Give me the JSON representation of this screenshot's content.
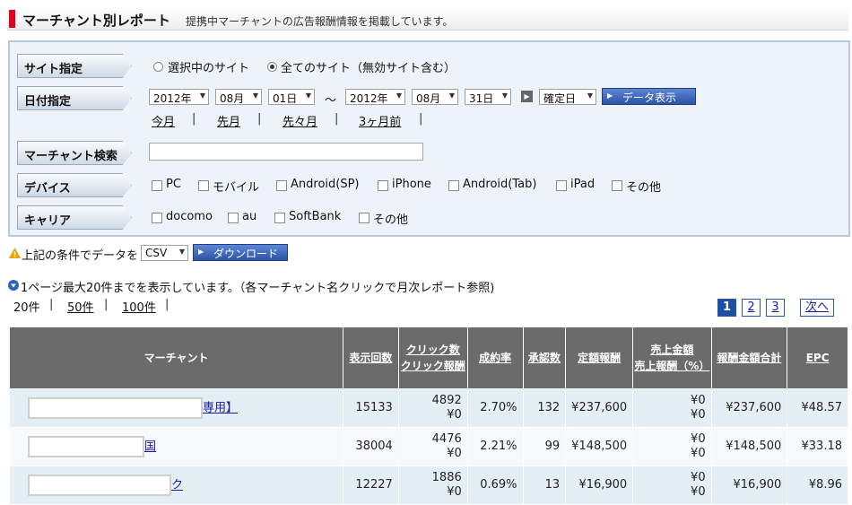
{
  "title": {
    "main": "マーチャント別レポート",
    "sub": "提携中マーチャントの広告報酬情報を掲載しています。"
  },
  "filters": {
    "site_label": "サイト指定",
    "site_options": [
      "選択中のサイト",
      "全てのサイト（無効サイト含む）"
    ],
    "site_selected": 1,
    "date_label": "日付指定",
    "from": {
      "year": "2012年",
      "month": "08月",
      "day": "01日"
    },
    "tilde": "～",
    "to": {
      "year": "2012年",
      "month": "08月",
      "day": "31日"
    },
    "date_type": "確定日",
    "show_button": "データ表示",
    "quick_links": [
      "今月",
      "先月",
      "先々月",
      "3ヶ月前"
    ],
    "merchant_search_label": "マーチャント検索",
    "merchant_search_value": "",
    "device_label": "デバイス",
    "devices": [
      "PC",
      "モバイル",
      "Android(SP)",
      "iPhone",
      "Android(Tab)",
      "iPad",
      "その他"
    ],
    "carrier_label": "キャリア",
    "carriers": [
      "docomo",
      "au",
      "SoftBank",
      "その他"
    ]
  },
  "download": {
    "label": "上記の条件でデータを",
    "format": "CSV",
    "button": "ダウンロード"
  },
  "notice": "1ページ最大20件までを表示しています。（各マーチャント名クリックで月次レポート参照)",
  "per_page": {
    "current": "20件",
    "options": [
      "50件",
      "100件"
    ]
  },
  "pagination": {
    "pages": [
      "1",
      "2",
      "3"
    ],
    "current": "1",
    "next": "次へ"
  },
  "table": {
    "headers": {
      "merchant": "マーチャント",
      "impressions": "表示回数",
      "clicks": "クリック数",
      "click_reward": "クリック報酬",
      "cvr": "成約率",
      "approved": "承認数",
      "fixed_reward": "定額報酬",
      "sales_amount": "売上金額",
      "sales_reward": "売上報酬（%）",
      "reward_total": "報酬金額合計",
      "epc": "EPC"
    },
    "rows": [
      {
        "merchant": "専用】",
        "impressions": "15133",
        "clicks": "4892",
        "click_reward": "¥0",
        "cvr": "2.70%",
        "approved": "132",
        "fixed_reward": "¥237,600",
        "sales_amount": "¥0",
        "sales_reward": "¥0",
        "reward_total": "¥237,600",
        "epc": "¥48.57"
      },
      {
        "merchant": "国",
        "impressions": "38004",
        "clicks": "4476",
        "click_reward": "¥0",
        "cvr": "2.21%",
        "approved": "99",
        "fixed_reward": "¥148,500",
        "sales_amount": "¥0",
        "sales_reward": "¥0",
        "reward_total": "¥148,500",
        "epc": "¥33.18"
      },
      {
        "merchant": "ク",
        "impressions": "12227",
        "clicks": "1886",
        "click_reward": "¥0",
        "cvr": "0.69%",
        "approved": "13",
        "fixed_reward": "¥16,900",
        "sales_amount": "¥0",
        "sales_reward": "¥0",
        "reward_total": "¥16,900",
        "epc": "¥8.96"
      }
    ]
  }
}
